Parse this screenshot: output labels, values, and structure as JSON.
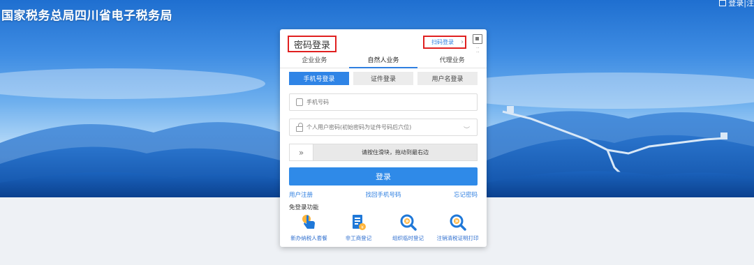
{
  "header": {
    "site_title": "国家税务总局四川省电子税务局",
    "top_login": "登录|注"
  },
  "login_card": {
    "title": "密码登录",
    "qr_login": "扫码登录",
    "tabs": [
      {
        "label": "企业业务",
        "active": false
      },
      {
        "label": "自然人业务",
        "active": true
      },
      {
        "label": "代理业务",
        "active": false
      }
    ],
    "subtabs": [
      {
        "label": "手机号登录",
        "active": true
      },
      {
        "label": "证件登录",
        "active": false
      },
      {
        "label": "用户名登录",
        "active": false
      }
    ],
    "phone_placeholder": "手机号码",
    "password_placeholder": "个人用户密码(初始密码为证件号码后六位)",
    "slider_text": "请按住滑块，拖动到最右边",
    "login_button": "登录",
    "links": {
      "register": "用户注册",
      "recover_phone": "找回手机号码",
      "forgot_password": "忘记密码"
    },
    "free_login_label": "免登录功能",
    "quick_items": [
      {
        "label": "新办纳税人套餐",
        "icon": "hand-pointer-icon"
      },
      {
        "label": "非工商登记",
        "icon": "document-icon"
      },
      {
        "label": "组织临时登记",
        "icon": "magnifier-icon"
      },
      {
        "label": "注销清税证明打印",
        "icon": "magnifier-icon"
      }
    ]
  },
  "colors": {
    "accent": "#2f8ae8",
    "highlight_border": "#e02020"
  }
}
